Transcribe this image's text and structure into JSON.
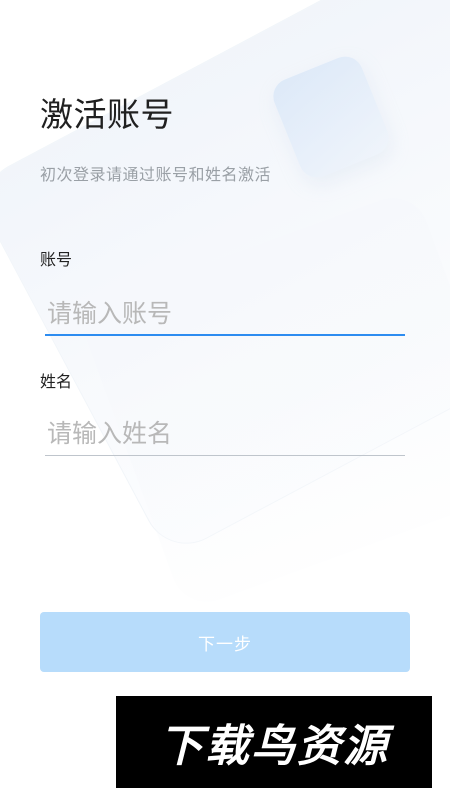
{
  "header": {
    "title": "激活账号",
    "subtitle": "初次登录请通过账号和姓名激活"
  },
  "form": {
    "account": {
      "label": "账号",
      "placeholder": "请输入账号",
      "value": ""
    },
    "name": {
      "label": "姓名",
      "placeholder": "请输入姓名",
      "value": ""
    }
  },
  "actions": {
    "next_label": "下一步"
  },
  "watermark": {
    "text": "下载鸟资源"
  },
  "colors": {
    "accent": "#2d8cf0",
    "button_disabled": "#b7dcfb",
    "title": "#202020",
    "subtitle": "#9aa0a6"
  }
}
